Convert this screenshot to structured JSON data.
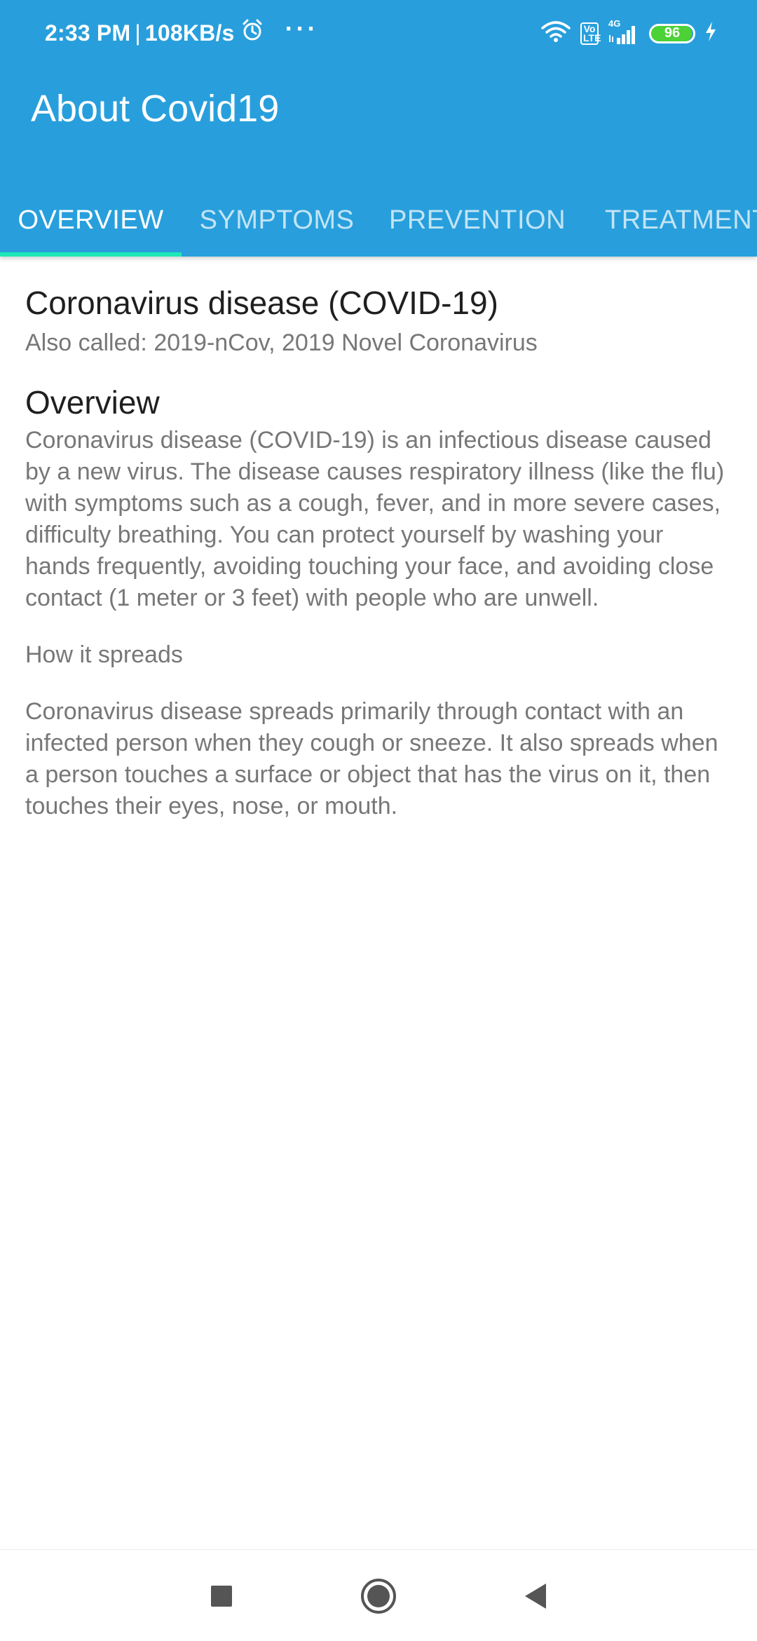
{
  "status_bar": {
    "time": "2:33 PM",
    "separator": "|",
    "speed": "108KB/s",
    "more": "···",
    "volte_top": "Vo",
    "volte_bottom": "LTE",
    "network": "4G",
    "battery_percent": 96,
    "battery_label": "96"
  },
  "app_bar": {
    "title": "About Covid19"
  },
  "tabs": [
    {
      "label": "OVERVIEW",
      "active": true
    },
    {
      "label": "SYMPTOMS",
      "active": false
    },
    {
      "label": "PREVENTION",
      "active": false
    },
    {
      "label": "TREATMENTS",
      "active": false
    }
  ],
  "content": {
    "heading": "Coronavirus disease (COVID-19)",
    "also_called": "Also called: 2019-nCov, 2019 Novel Coronavirus",
    "section_title": "Overview",
    "overview_text": "Coronavirus disease (COVID-19) is an infectious disease caused by a new virus. The disease causes respiratory illness (like the flu) with symptoms such as a cough, fever, and in more severe cases, difficulty breathing. You can protect yourself by washing your hands frequently, avoiding touching your face, and avoiding close contact (1 meter or 3 feet) with people who are unwell.",
    "spread_title": "How it spreads",
    "spread_text": "Coronavirus disease spreads primarily through contact with an infected person when they cough or sneeze. It also spreads when a person touches a surface or object that has the virus on it, then touches their eyes, nose, or mouth."
  },
  "nav_bar": {
    "buttons": [
      "recents-icon",
      "home-icon",
      "back-icon"
    ]
  },
  "colors": {
    "app_bar": "#289fdc",
    "tab_indicator": "#1de9b6",
    "battery_fill": "#4cd137",
    "body_text": "#777777",
    "heading_text": "#1f1f1f"
  }
}
